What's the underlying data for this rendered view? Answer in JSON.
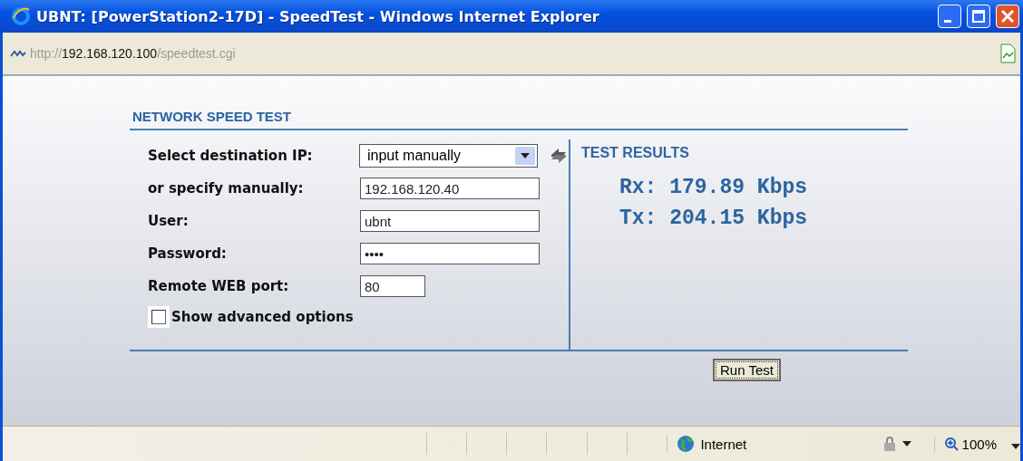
{
  "window": {
    "title": "UBNT: [PowerStation2-17D] - SpeedTest - Windows Internet Explorer"
  },
  "address": {
    "scheme": "http://",
    "host": "192.168.120.100",
    "path": "/speedtest.cgi"
  },
  "section_title": "NETWORK SPEED TEST",
  "form": [
    {
      "kind": "select",
      "label": "Select destination IP:",
      "value": "input manually"
    },
    {
      "kind": "text",
      "label": "or specify manually:",
      "value": "192.168.120.40"
    },
    {
      "kind": "text",
      "label": "User:",
      "value": "ubnt"
    },
    {
      "kind": "password",
      "label": "Password:",
      "value": "••••"
    },
    {
      "kind": "short",
      "label": "Remote WEB port:",
      "value": "80"
    }
  ],
  "advanced": {
    "label": "Show advanced options",
    "checked": false
  },
  "results": {
    "title": "TEST RESULTS",
    "lines": [
      "Rx: 179.89 Kbps",
      "Tx: 204.15 Kbps"
    ]
  },
  "run_button": "Run Test",
  "status_bar": {
    "zone": "Internet",
    "zoom": "100%"
  }
}
